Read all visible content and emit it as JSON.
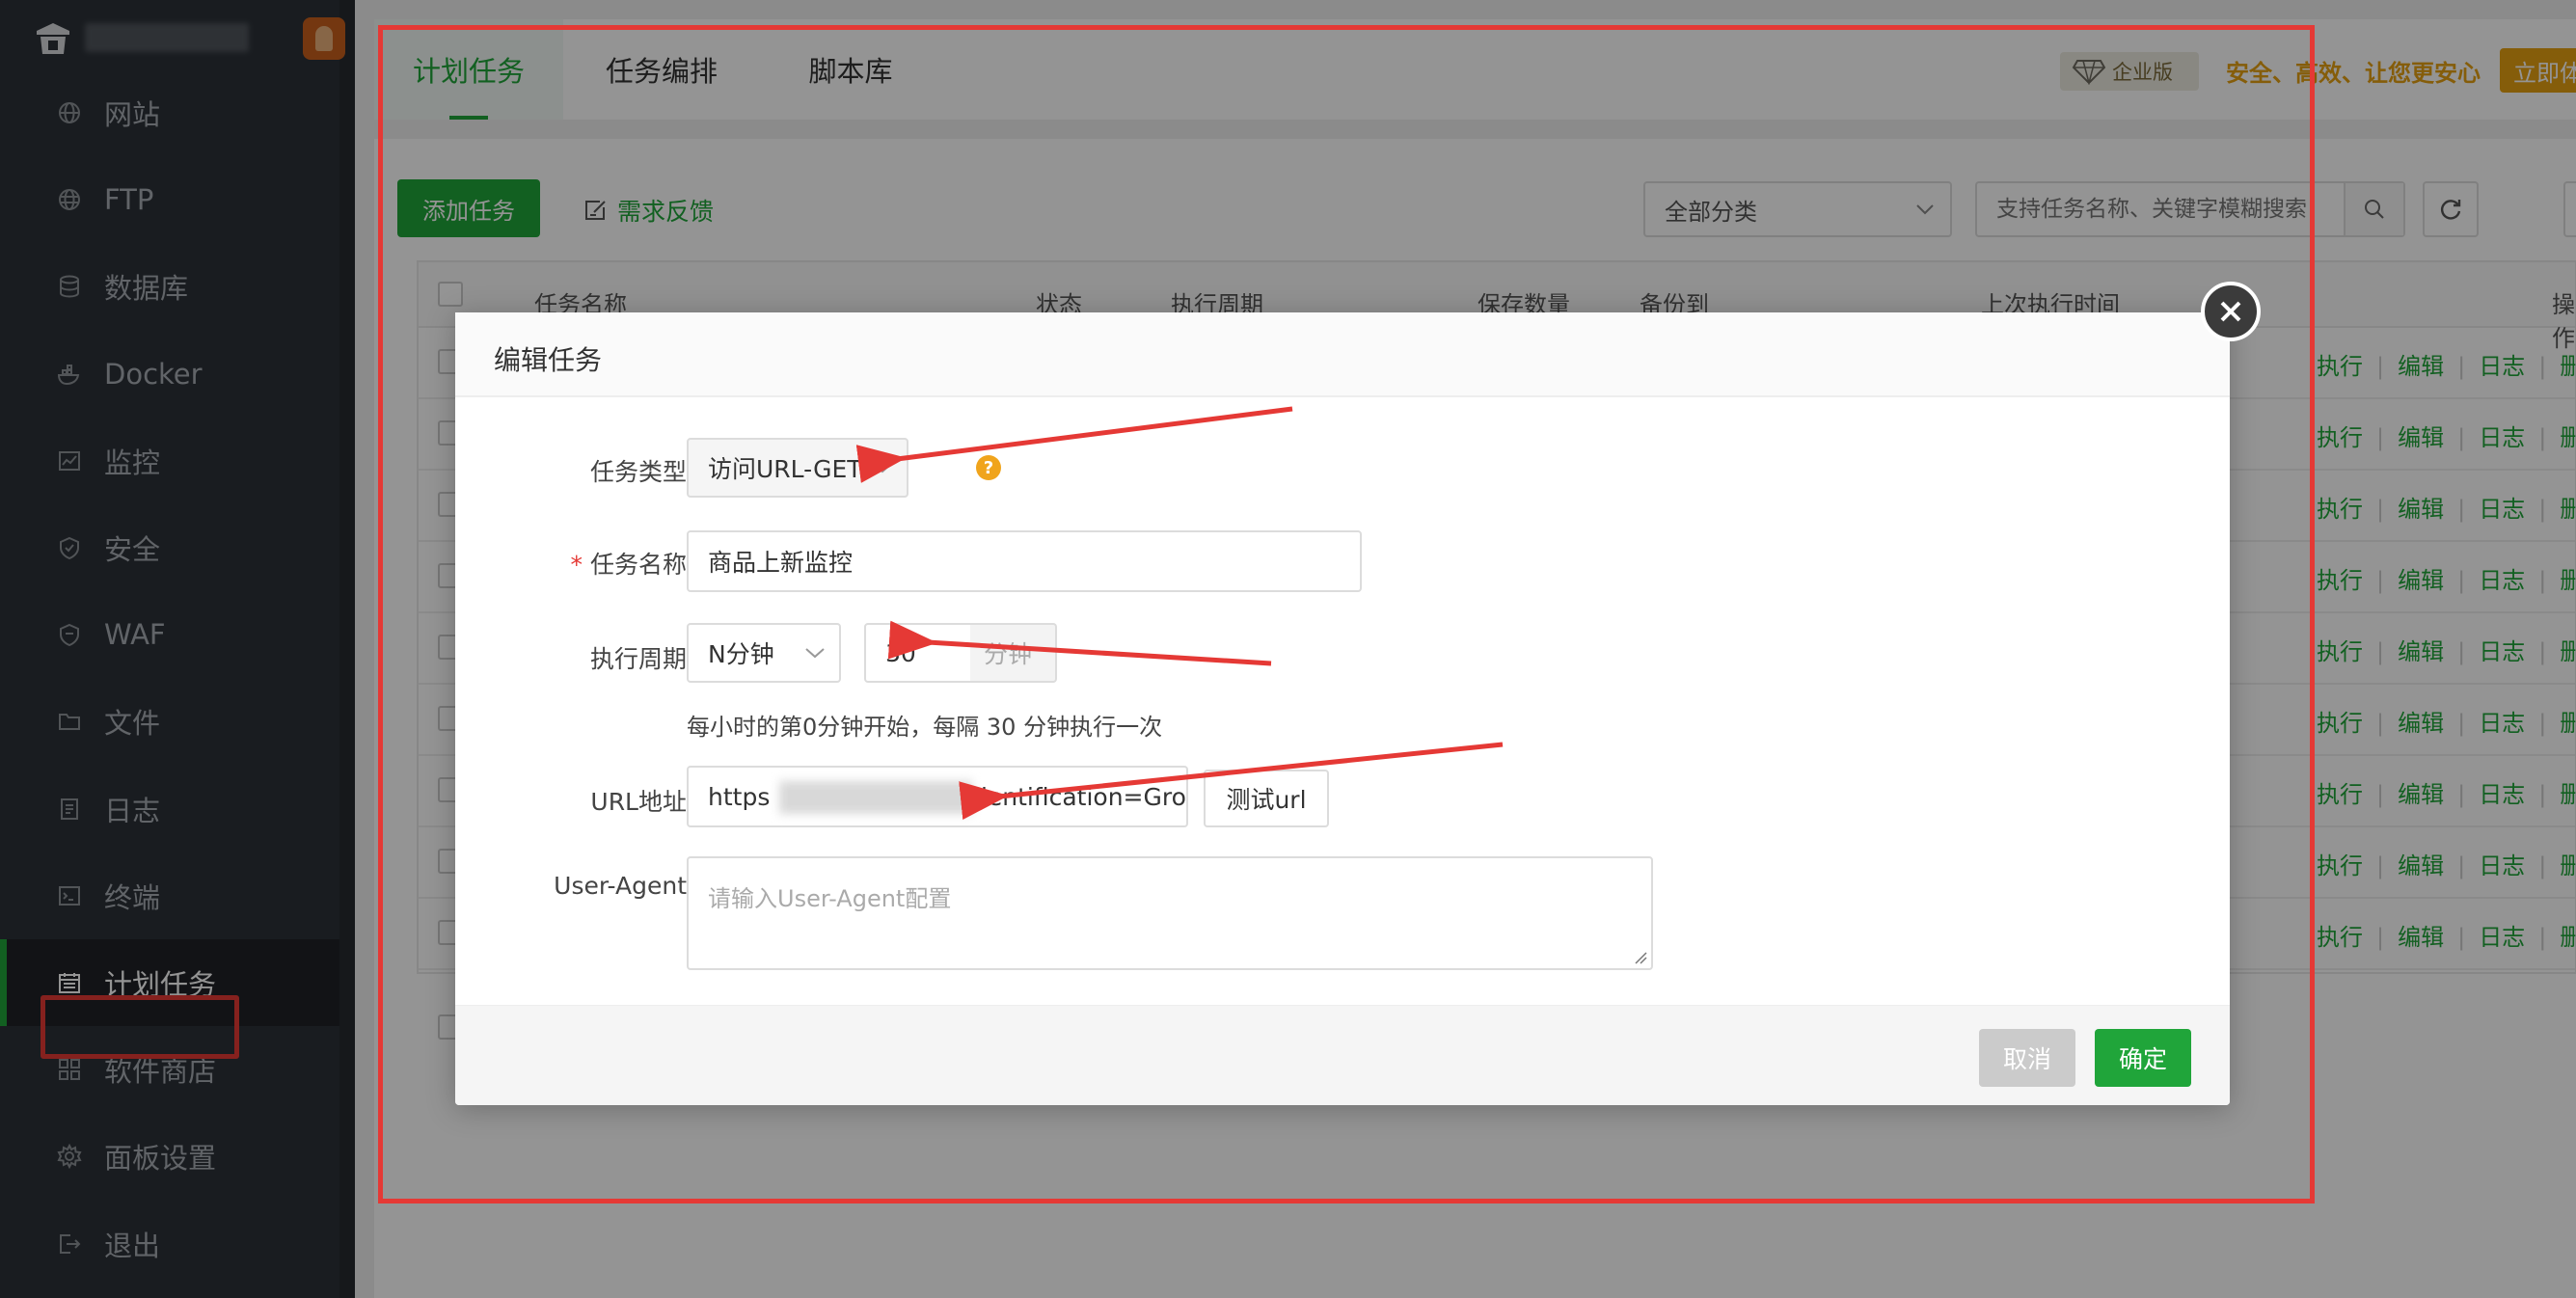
{
  "sidebar": {
    "items": [
      {
        "label": "网站",
        "icon": "globe-icon"
      },
      {
        "label": "FTP",
        "icon": "ftp-globe-icon"
      },
      {
        "label": "数据库",
        "icon": "database-icon"
      },
      {
        "label": "Docker",
        "icon": "docker-icon"
      },
      {
        "label": "监控",
        "icon": "monitor-icon"
      },
      {
        "label": "安全",
        "icon": "shield-icon"
      },
      {
        "label": "WAF",
        "icon": "waf-shield-icon"
      },
      {
        "label": "文件",
        "icon": "folder-icon"
      },
      {
        "label": "日志",
        "icon": "log-icon"
      },
      {
        "label": "终端",
        "icon": "terminal-icon"
      },
      {
        "label": "计划任务",
        "icon": "calendar-icon",
        "active": true
      },
      {
        "label": "软件商店",
        "icon": "grid-icon"
      },
      {
        "label": "面板设置",
        "icon": "gear-icon"
      },
      {
        "label": "退出",
        "icon": "logout-icon"
      }
    ]
  },
  "tabs": [
    {
      "label": "计划任务",
      "active": true
    },
    {
      "label": "任务编排"
    },
    {
      "label": "脚本库"
    }
  ],
  "enterprise": {
    "badge": "企业版",
    "slogan": "安全、高效、让您更安心",
    "buy": "立即体验"
  },
  "toolbar": {
    "add_task": "添加任务",
    "feedback": "需求反馈",
    "category": "全部分类",
    "search_placeholder": "支持任务名称、关键字模糊搜索"
  },
  "table": {
    "headers": [
      "任务名称",
      "状态",
      "执行周期",
      "保存数量",
      "备份到",
      "上次执行时间",
      "操作"
    ],
    "row_actions": [
      "执行",
      "编辑",
      "日志",
      "删除"
    ],
    "row_count": 9
  },
  "modal": {
    "title": "编辑任务",
    "labels": {
      "task_type": "任务类型",
      "task_name": "任务名称",
      "required_mark": "*",
      "period": "执行周期",
      "url": "URL地址",
      "user_agent": "User-Agent"
    },
    "task_type_value": "访问URL-GET",
    "task_name_value": "商品上新监控",
    "period_type": "N分钟",
    "period_value": "30",
    "period_unit": "分钟",
    "period_hint": "每小时的第0分钟开始，每隔 30 分钟执行一次",
    "url_value_start": "https",
    "url_value_end": "dentification=Gro",
    "test_url": "测试url",
    "user_agent_placeholder": "请输入User-Agent配置",
    "cancel": "取消",
    "confirm": "确定",
    "help_mark": "?"
  },
  "colors": {
    "accent": "#20a53a",
    "sidebar_bg": "#2c3138",
    "annotation_red": "#e53935",
    "enterprise_gold": "#e6a012"
  }
}
